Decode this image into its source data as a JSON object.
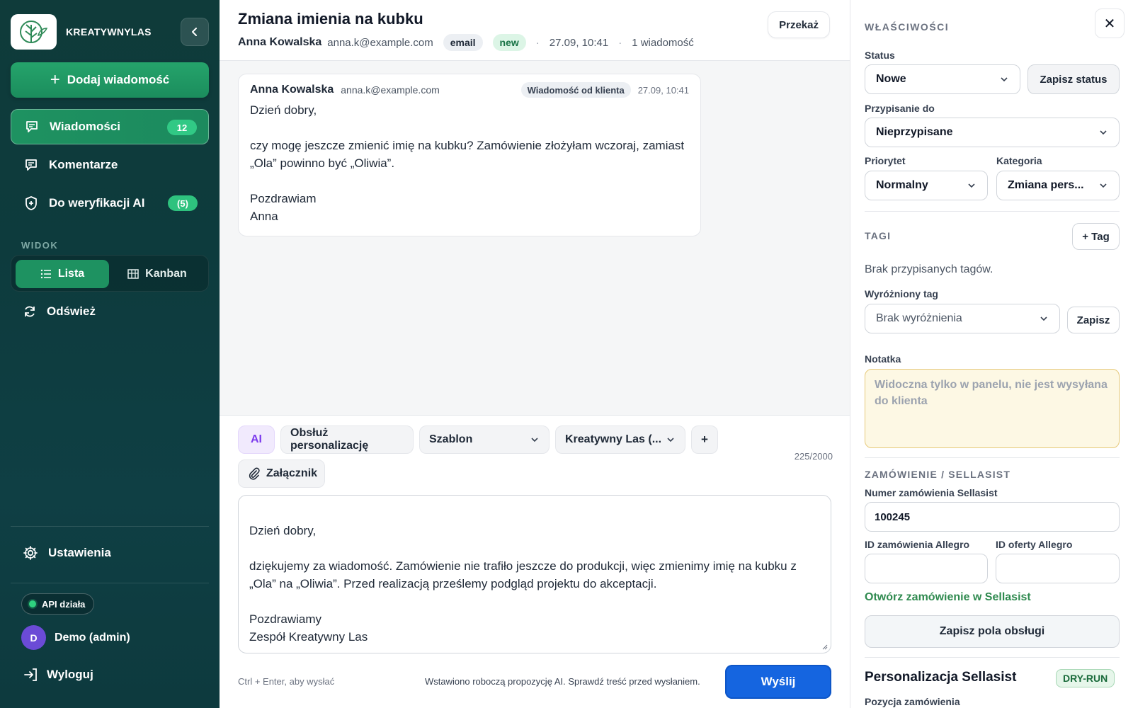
{
  "sidebar": {
    "brand": "KREATYWNYLAS",
    "add_button": "Dodaj wiadomość",
    "nav": [
      {
        "label": "Wiadomości",
        "badge": "12"
      },
      {
        "label": "Komentarze",
        "badge": ""
      },
      {
        "label": "Do weryfikacji AI",
        "badge": "(5)"
      }
    ],
    "view_label": "WIDOK",
    "view_options": [
      "Lista",
      "Kanban"
    ],
    "refresh": "Odśwież",
    "settings": "Ustawienia",
    "api_status": "API działa",
    "user_initial": "D",
    "user_name": "Demo (admin)",
    "logout": "Wyloguj"
  },
  "thread": {
    "title": "Zmiana imienia na kubku",
    "sender_name": "Anna Kowalska",
    "sender_email": "anna.k@example.com",
    "channel": "email",
    "status_tag": "new",
    "datetime": "27.09, 10:41",
    "message_count": "1 wiadomość",
    "forward": "Przekaż"
  },
  "message": {
    "sender_name": "Anna Kowalska",
    "sender_email": "anna.k@example.com",
    "origin_badge": "Wiadomość od klienta",
    "time": "27.09, 10:41",
    "body": "Dzień dobry,\n\nczy mogę jeszcze zmienić imię na kubku? Zamówienie złożyłam wczoraj, zamiast „Ola” powinno być „Oliwia”.\n\nPozdrawiam\nAnna"
  },
  "composer": {
    "ai": "AI",
    "personalize": "Obsłuż personalizację",
    "template": "Szablon",
    "signature": "Kreatywny Las (...",
    "plus": "+",
    "attachment": "Załącznik",
    "counter": "225/2000",
    "reply": "Dzień dobry,\n\ndziękujemy za wiadomość. Zamówienie nie trafiło jeszcze do produkcji, więc zmienimy imię na kubku z „Ola” na „Oliwia”. Przed realizacją prześlemy podgląd projektu do akceptacji.\n\nPozdrawiamy\nZespół Kreatywny Las",
    "hint": "Ctrl + Enter, aby wysłać",
    "draft_note": "Wstawiono roboczą propozycję AI. Sprawdź treść przed wysłaniem.",
    "send": "Wyślij"
  },
  "props": {
    "title": "WŁAŚCIWOŚCI",
    "close": "✕",
    "status_label": "Status",
    "status_value": "Nowe",
    "save_status": "Zapisz status",
    "assign_label": "Przypisanie do",
    "assign_value": "Nieprzypisane",
    "priority_label": "Priorytet",
    "priority_value": "Normalny",
    "category_label": "Kategoria",
    "category_value": "Zmiana pers...",
    "tags_title": "TAGI",
    "add_tag": "+ Tag",
    "no_tags": "Brak przypisanych tagów.",
    "featured_label": "Wyróżniony tag",
    "featured_value": "Brak wyróżnienia",
    "featured_save": "Zapisz",
    "note_label": "Notatka",
    "note_placeholder": "Widoczna tylko w panelu, nie jest wysyłana do klienta",
    "order_title": "ZAMÓWIENIE / SELLASIST",
    "order_no_label": "Numer zamówienia Sellasist",
    "order_no_value": "100245",
    "allegro_order_label": "ID zamówienia Allegro",
    "allegro_offer_label": "ID oferty Allegro",
    "open_link": "Otwórz zamówienie w Sellasist",
    "save_fields": "Zapisz pola obsługi",
    "pers_title": "Personalizacja Sellasist",
    "dry_run": "DRY-RUN",
    "position_label": "Pozycja zamówienia"
  }
}
